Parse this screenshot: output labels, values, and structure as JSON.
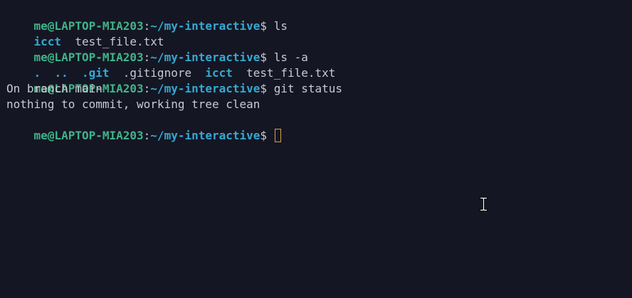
{
  "prompt": {
    "user_host": "me@LAPTOP-MIA203",
    "colon": ":",
    "path": "~/my-interactive",
    "dollar": "$"
  },
  "lines": [
    {
      "command": "ls"
    },
    {
      "entries": [
        {
          "text": "icct",
          "type": "dir"
        },
        {
          "text": "test_file.txt",
          "type": "file"
        }
      ]
    },
    {
      "command": "ls -a"
    },
    {
      "entries": [
        {
          "text": ".",
          "type": "dir"
        },
        {
          "text": "..",
          "type": "dir"
        },
        {
          "text": ".git",
          "type": "dir"
        },
        {
          "text": ".gitignore",
          "type": "file"
        },
        {
          "text": "icct",
          "type": "dir"
        },
        {
          "text": "test_file.txt",
          "type": "file"
        }
      ]
    },
    {
      "command": "git status"
    },
    {
      "output": "On branch main"
    },
    {
      "output": "nothing to commit, working tree clean"
    }
  ],
  "colors": {
    "background": "#151623",
    "user_host": "#3fb489",
    "path": "#34a9d2",
    "text": "#c8c9d3",
    "cursor": "#d7a440"
  },
  "icons": {
    "cursor": "text-cursor-ibeam-icon"
  }
}
